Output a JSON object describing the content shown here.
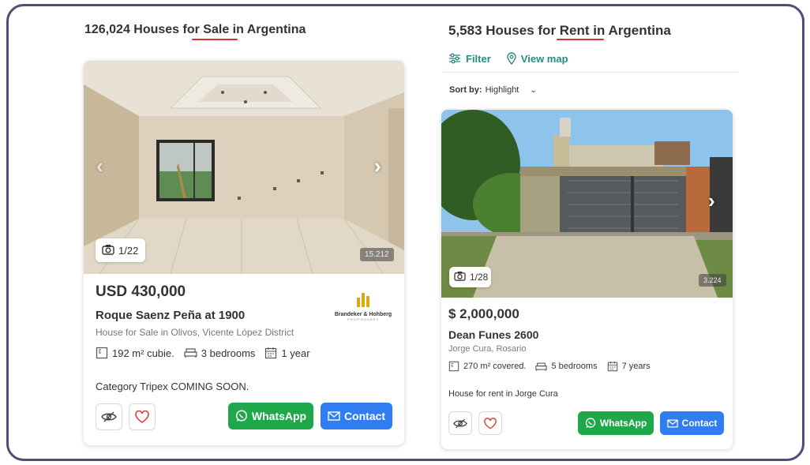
{
  "sale": {
    "title_prefix": "126,024 Houses for ",
    "title_highlight": "Sale in",
    "title_suffix": " Argentina",
    "listing": {
      "photo_counter": "1/22",
      "ref": "15.212",
      "price": "USD 430,000",
      "address": "Roque Saenz Peña at 1900",
      "subtitle": "House for Sale in Olivos, Vicente López District",
      "agency_name": "Brandeker & Hohberg",
      "agency_tag": "PROPIEDADES",
      "features": [
        {
          "icon": "area-icon",
          "text": "192 m² cubie."
        },
        {
          "icon": "bed-icon",
          "text": "3 bedrooms"
        },
        {
          "icon": "calendar-icon",
          "text": "1 year"
        }
      ],
      "description": "Category Tripex COMING SOON.",
      "whatsapp_label": "WhatsApp",
      "contact_label": "Contact"
    }
  },
  "rent": {
    "title_prefix": "5,583 Houses for ",
    "title_highlight": "Rent in",
    "title_suffix": " Argentina",
    "filter_label": "Filter",
    "map_label": "View map",
    "sort_label": "Sort by:",
    "sort_value": "Highlight",
    "listing": {
      "photo_counter": "1/28",
      "ref": "3.224",
      "price": "$ 2,000,000",
      "address": "Dean Funes 2600",
      "subtitle": "Jorge Cura, Rosario",
      "features": [
        {
          "icon": "area-icon",
          "text": "270 m² covered."
        },
        {
          "icon": "bed-icon",
          "text": "5 bedrooms"
        },
        {
          "icon": "calendar-icon",
          "text": "7 years"
        }
      ],
      "description": "House for rent in Jorge Cura",
      "whatsapp_label": "WhatsApp",
      "contact_label": "Contact"
    }
  },
  "colors": {
    "frame": "#4b4f7a",
    "underline": "#d6342b",
    "whatsapp": "#1fa84a",
    "contact": "#2f7df0",
    "toolbar_teal": "#2b8a7e"
  }
}
